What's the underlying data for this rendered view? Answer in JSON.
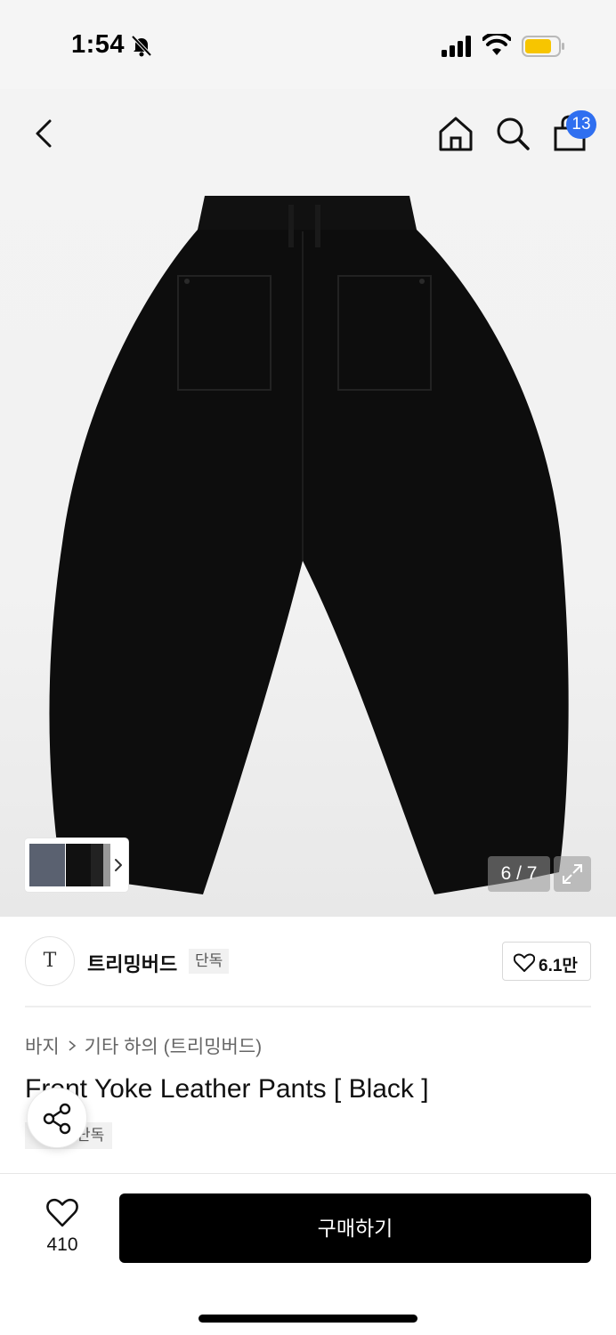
{
  "status_bar": {
    "time": "1:54",
    "icons": [
      "bell-slash-icon",
      "signal-icon",
      "wifi-icon",
      "battery-icon"
    ],
    "battery_color": "#f7c500"
  },
  "nav": {
    "icons": [
      "chevron-left-icon",
      "home-icon",
      "search-icon",
      "shopping-bag-icon"
    ],
    "cart_count": "13",
    "badge_color": "#2f6ff0"
  },
  "gallery": {
    "page_counter": "6 / 7",
    "thumbnail_arrow": "chevron-right-icon",
    "expand_icon": "expand-icon"
  },
  "brand": {
    "logo_text": "T",
    "name": "트리밍버드",
    "exclusive_tag": "단독",
    "likes": "6.1만"
  },
  "product": {
    "breadcrumb": [
      "바지",
      "기타 하의 (트리밍버드)"
    ],
    "title": "Front Yoke Leather Pants [ Black ]",
    "tag": "단독"
  },
  "bottom_bar": {
    "wish_count": "410",
    "buy_label": "구매하기"
  }
}
